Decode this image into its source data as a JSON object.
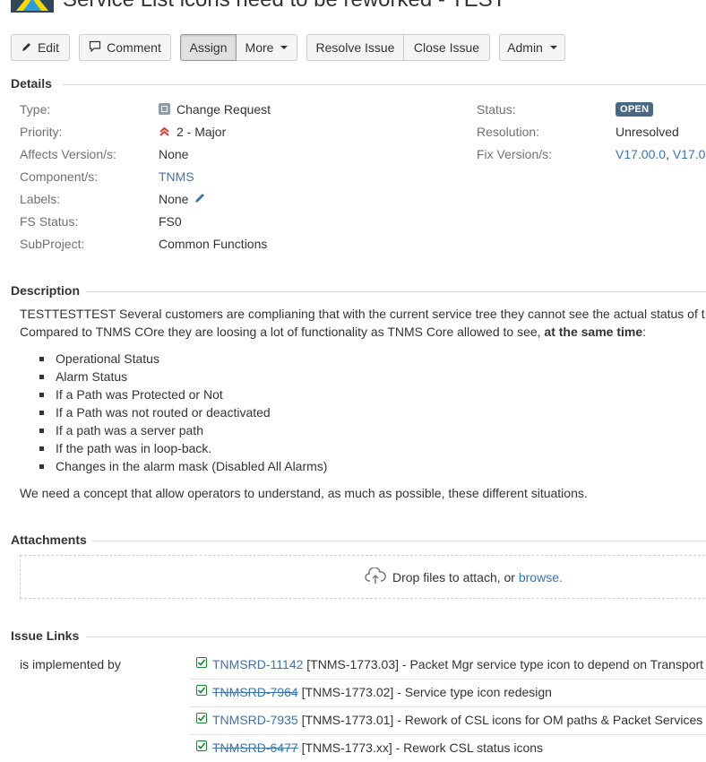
{
  "issue": {
    "title": "Service List icons need to be reworked - TEST"
  },
  "toolbar": {
    "edit": "Edit",
    "comment": "Comment",
    "assign": "Assign",
    "more": "More",
    "resolve": "Resolve Issue",
    "close": "Close Issue",
    "admin": "Admin"
  },
  "details": {
    "heading": "Details",
    "left": [
      {
        "label": "Type:",
        "value": "Change Request"
      },
      {
        "label": "Priority:",
        "value": "2 - Major"
      },
      {
        "label": "Affects Version/s:",
        "value": "None"
      },
      {
        "label": "Component/s:",
        "value": "TNMS"
      },
      {
        "label": "Labels:",
        "value": "None"
      },
      {
        "label": "FS Status:",
        "value": "FS0"
      },
      {
        "label": "SubProject:",
        "value": "Common Functions"
      }
    ],
    "right": [
      {
        "label": "Status:",
        "value": "OPEN"
      },
      {
        "label": "Resolution:",
        "value": "Unresolved"
      },
      {
        "label": "Fix Version/s:",
        "value": "V17.00.0",
        "value2": "V17.0"
      }
    ],
    "fix_sep": ","
  },
  "description": {
    "heading": "Description",
    "line1": "TESTTESTTEST Several customers are complianing that with the current service tree they cannot see the actual status of t",
    "line2_prefix": "Compared to TNMS COre they are loosing a lot of functionality as TNMS Core allowed to see, ",
    "line2_bold": "at the same time",
    "line2_suffix": ":",
    "items": [
      "Operational Status",
      "Alarm Status",
      "If a Path was Protected or Not",
      "If a Path was not routed or deactivated",
      "If a path was a server path",
      "If the path was in loop-back.",
      "Changes in the alarm mask (Disabled All Alarms)"
    ],
    "closing": "We need a concept that allow operators to understand, as much as possible, these different situations."
  },
  "attachments": {
    "heading": "Attachments",
    "drop_text": "Drop files to attach, or ",
    "browse": "browse."
  },
  "issue_links": {
    "heading": "Issue Links",
    "relation": "is implemented by",
    "links": [
      {
        "key": "TNMSRD-11142",
        "summary": "[TNMS-1773.03] - Packet Mgr service type icon to depend on Transport",
        "resolved": false
      },
      {
        "key": "TNMSRD-7964",
        "summary": "[TNMS-1773.02] - Service type icon redesign",
        "resolved": true
      },
      {
        "key": "TNMSRD-7935",
        "summary": "[TNMS-1773.01] - Rework of CSL icons for OM paths & Packet Services",
        "resolved": false
      },
      {
        "key": "TNMSRD-6477",
        "summary": "[TNMS-1773.xx] - Rework CSL status icons",
        "resolved": true
      }
    ]
  },
  "colors": {
    "link": "#3b73af",
    "status_lozenge": "#4a6785",
    "priority": "#d04437",
    "check": "#14892c"
  }
}
